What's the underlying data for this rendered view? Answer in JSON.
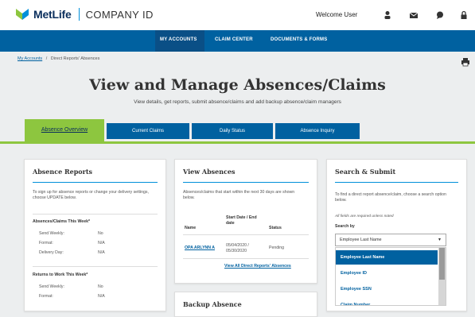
{
  "header": {
    "brand": "MetLife",
    "brand_sub": "COMPANY ID",
    "welcome": "Welcome User",
    "icons": [
      "user-icon",
      "mail-icon",
      "chat-icon",
      "lock-icon"
    ]
  },
  "nav": {
    "items": [
      "MY ACCOUNTS",
      "CLAIM CENTER",
      "DOCUMENTS & FORMS"
    ]
  },
  "breadcrumb": {
    "home": "My Accounts",
    "sep": "/",
    "current": "Direct Reports' Absences"
  },
  "page": {
    "title": "View and Manage Absences/Claims",
    "subtitle": "View details, get reports, submit absence/claims and add backup absence/claim managers"
  },
  "tabs": [
    "Absence Overview",
    "Current Claims",
    "Daily Status",
    "Absence Inquiry"
  ],
  "absence_reports": {
    "title": "Absence Reports",
    "intro": "To sign up for absence reports or change your delivery settings, choose UPDATE below.",
    "section1": "Absences/Claims This Week*",
    "rows1": [
      {
        "label": "Send Weekly:",
        "value": "No"
      },
      {
        "label": "Format:",
        "value": "N/A"
      },
      {
        "label": "Delivery Day:",
        "value": "N/A"
      }
    ],
    "section2": "Returns to Work This Week*",
    "rows2": [
      {
        "label": "Send Weekly:",
        "value": "No"
      },
      {
        "label": "Format:",
        "value": "N/A"
      }
    ]
  },
  "view_absences": {
    "title": "View Absences",
    "intro": "Absences/claims that start within the next 30 days are shown below.",
    "col_name": "Name",
    "col_dates": "Start Date / End date",
    "col_status": "Status",
    "row_name": "OPA ARLYNN A",
    "row_dates": "05/04/2020 / 05/30/2020",
    "row_status": "Pending",
    "link": "View All Direct Reports' Absences",
    "next_title": "Backup Absence"
  },
  "search": {
    "title": "Search & Submit",
    "intro": "To find a direct report absence/claim, choose a search option below.",
    "required": "All fields are required unless noted",
    "label": "Search by",
    "selected": "Employee Last Name",
    "options": [
      "Employee Last Name",
      "Employee ID",
      "Employee SSN",
      "Claim Number"
    ]
  }
}
